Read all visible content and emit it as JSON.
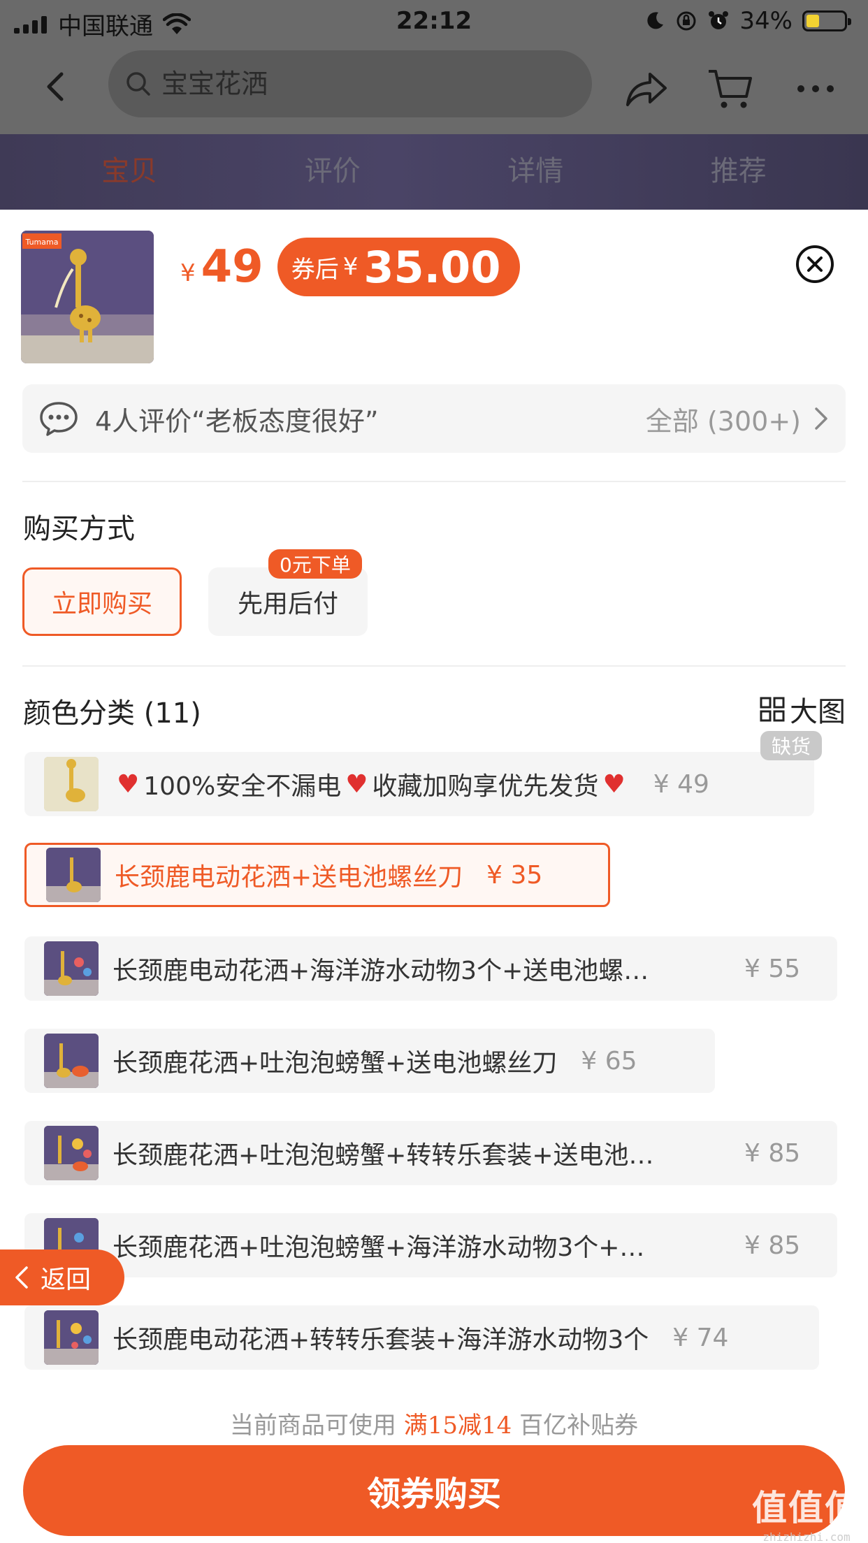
{
  "status_bar": {
    "carrier": "中国联通",
    "time": "22:12",
    "battery": "34%",
    "icons": [
      "signal-icon",
      "wifi-icon",
      "moon-icon",
      "rotation-lock-icon",
      "alarm-icon",
      "battery-icon"
    ]
  },
  "nav": {
    "search_placeholder": "宝宝花洒",
    "icons": [
      "back-arrow-icon",
      "search-icon",
      "share-icon",
      "cart-icon",
      "more-icon"
    ]
  },
  "tabs": [
    {
      "label": "宝贝",
      "active": true
    },
    {
      "label": "评价",
      "active": false
    },
    {
      "label": "详情",
      "active": false
    },
    {
      "label": "推荐",
      "active": false
    }
  ],
  "product": {
    "currency": "¥",
    "price": "49",
    "coupon_label": "券后",
    "coupon_currency": "¥",
    "coupon_price": "35.00",
    "thumb_brand": "Tumama"
  },
  "review": {
    "text": "4人评价“老板态度很好”",
    "all": "全部 (300+)"
  },
  "purchase": {
    "title": "购买方式",
    "options": [
      {
        "label": "立即购买",
        "selected": true
      },
      {
        "label": "先用后付",
        "selected": false
      }
    ],
    "later_badge": "0元下单"
  },
  "color_section": {
    "title": "颜色分类 (11)",
    "big_image": "大图",
    "soldout_tag": "缺货",
    "skus": [
      {
        "parts": [
          "100%安全不漏电",
          "收藏加购享优先发货"
        ],
        "price": "¥ 49",
        "soldout": true
      },
      {
        "name": "长颈鹿电动花洒+送电池螺丝刀",
        "price": "¥ 35",
        "selected": true
      },
      {
        "name": "长颈鹿电动花洒+海洋游水动物3个+送电池螺…",
        "price": "¥ 55"
      },
      {
        "name": "长颈鹿花洒+吐泡泡螃蟹+送电池螺丝刀",
        "price": "¥ 65"
      },
      {
        "name": "长颈鹿花洒+吐泡泡螃蟹+转转乐套装+送电池…",
        "price": "¥ 85"
      },
      {
        "name": "长颈鹿花洒+吐泡泡螃蟹+海洋游水动物3个+…",
        "price": "¥ 85"
      },
      {
        "name": "长颈鹿电动花洒+转转乐套装+海洋游水动物3个",
        "price": "¥ 74"
      }
    ]
  },
  "float_back": "返回",
  "coupon_note": {
    "prefix": "当前商品可使用",
    "highlight": "满15减14",
    "suffix": "百亿补贴券"
  },
  "cta": "领券购买",
  "watermark": {
    "big": "值值值",
    "small": "zhizhizhi.com"
  },
  "colors": {
    "accent": "#ef5a26",
    "accent_bg": "#fff7f3",
    "muted_bg": "#f5f5f5",
    "muted_text": "#999999",
    "heart": "#e0302f"
  }
}
